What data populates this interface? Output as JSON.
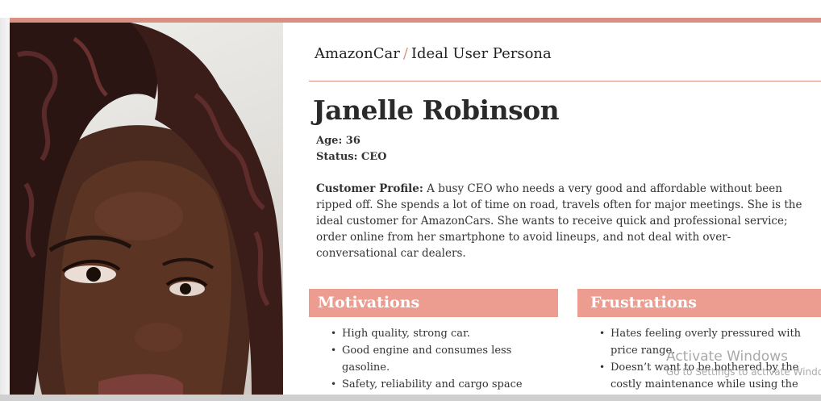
{
  "breadcrumb": {
    "root": "AmazonCar",
    "separator": "/",
    "current": "Ideal User Persona"
  },
  "persona": {
    "name": "Janelle Robinson",
    "age_label": "Age:",
    "age_value": "36",
    "status_label": "Status:",
    "status_value": "CEO",
    "profile_label": "Customer Profile:",
    "profile_text": "A busy CEO who needs a very good and affordable without been ripped off. She spends a lot of time on road, travels often for major meetings. She is the ideal customer for AmazonCars. She wants to receive quick and professional service; order online from her smartphone to avoid lineups, and not deal with over-conversational car dealers."
  },
  "motivations": {
    "title": "Motivations",
    "items": [
      "High quality, strong car.",
      "Good engine and consumes less gasoline.",
      "Safety, reliability and cargo space"
    ]
  },
  "frustrations": {
    "title": "Frustrations",
    "items": [
      "Hates feeling overly pressured with price range.",
      "Doesn’t want to be bothered by the costly maintenance while using the"
    ]
  },
  "watermark": {
    "title": "Activate Windows",
    "subtitle": "Go to Settings to activate Windows."
  },
  "colors": {
    "accent": "#d98f82",
    "section_header": "#ec9d8f"
  },
  "images": {
    "photo": "persona-portrait"
  }
}
